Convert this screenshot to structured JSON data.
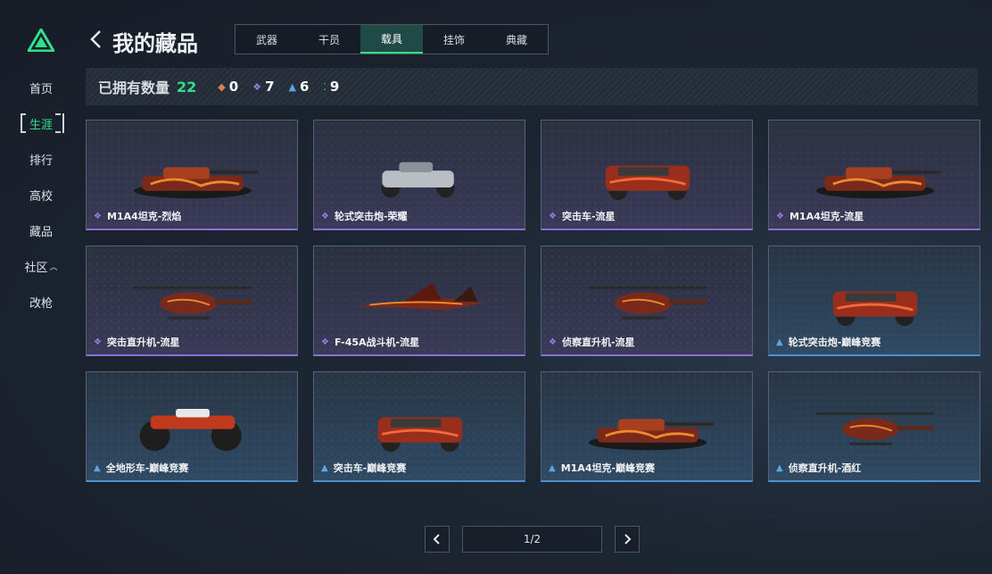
{
  "sidebar": {
    "items": [
      {
        "label": "首页"
      },
      {
        "label": "生涯",
        "active": true
      },
      {
        "label": "排行"
      },
      {
        "label": "高校"
      },
      {
        "label": "藏品"
      },
      {
        "label": "社区"
      },
      {
        "label": "改枪"
      }
    ]
  },
  "header": {
    "title": "我的藏品",
    "tabs": [
      {
        "label": "武器"
      },
      {
        "label": "干员"
      },
      {
        "label": "载具",
        "active": true
      },
      {
        "label": "挂饰"
      },
      {
        "label": "典藏"
      }
    ]
  },
  "stats": {
    "owned_label": "已拥有数量",
    "owned_count": "22",
    "rarities": [
      {
        "icon": "orange-diamond-icon",
        "color": "#d9844a",
        "count": "0"
      },
      {
        "icon": "purple-diamond-icon",
        "color": "#9b7fe6",
        "count": "7"
      },
      {
        "icon": "blue-chevron-icon",
        "color": "#5aa6e8",
        "count": "6"
      },
      {
        "icon": "green-dots-icon",
        "color": "#2fe08a",
        "count": "9"
      }
    ]
  },
  "items": [
    {
      "name": "M1A4坦克-烈焰",
      "rarity": "purple",
      "type": "tank"
    },
    {
      "name": "轮式突击炮-荣耀",
      "rarity": "purple",
      "type": "buggy"
    },
    {
      "name": "突击车-流星",
      "rarity": "purple",
      "type": "truck"
    },
    {
      "name": "M1A4坦克-流星",
      "rarity": "purple",
      "type": "tank"
    },
    {
      "name": "突击直升机-流星",
      "rarity": "purple",
      "type": "heli"
    },
    {
      "name": "F-45A战斗机-流星",
      "rarity": "purple",
      "type": "jet"
    },
    {
      "name": "侦察直升机-流星",
      "rarity": "purple",
      "type": "heli"
    },
    {
      "name": "轮式突击炮-巅峰竞赛",
      "rarity": "blue",
      "type": "truck"
    },
    {
      "name": "全地形车-巅峰竞赛",
      "rarity": "blue",
      "type": "atv"
    },
    {
      "name": "突击车-巅峰竞赛",
      "rarity": "blue",
      "type": "truck"
    },
    {
      "name": "M1A4坦克-巅峰竞赛",
      "rarity": "blue",
      "type": "tank"
    },
    {
      "name": "侦察直升机-酒红",
      "rarity": "blue",
      "type": "heli"
    }
  ],
  "pagination": {
    "current": "1/2"
  },
  "colors": {
    "accent": "#2fe08a",
    "purple": "#9b7fe6",
    "blue": "#5aa6e8"
  }
}
